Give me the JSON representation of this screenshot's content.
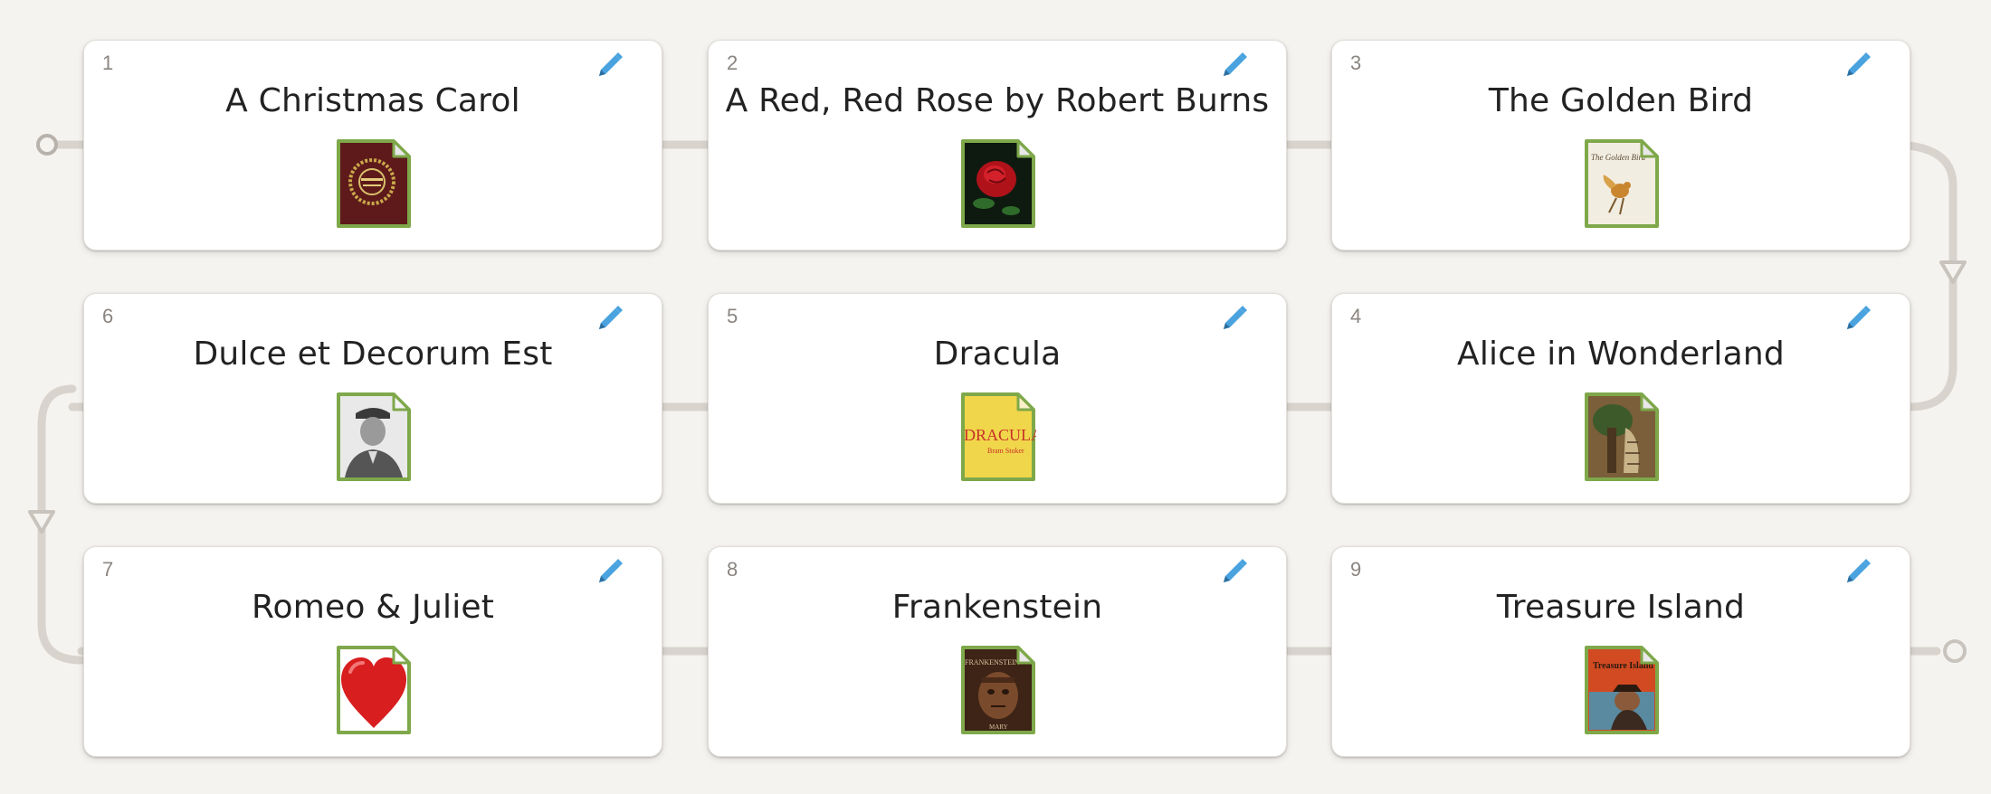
{
  "cards": [
    {
      "number": "1",
      "title": "A Christmas Carol",
      "thumb_icon": "christmas-carol-cover-icon"
    },
    {
      "number": "2",
      "title": "A Red, Red Rose by Robert Burns",
      "thumb_icon": "red-rose-icon"
    },
    {
      "number": "3",
      "title": "The Golden Bird",
      "thumb_icon": "golden-bird-cover-icon",
      "thumb_text": "The Golden Bird"
    },
    {
      "number": "4",
      "title": "Alice in Wonderland",
      "thumb_icon": "alice-cover-icon"
    },
    {
      "number": "5",
      "title": "Dracula",
      "thumb_icon": "dracula-cover-icon",
      "thumb_text": "DRACULA",
      "thumb_subtext": "Bram Stoker"
    },
    {
      "number": "6",
      "title": "Dulce et Decorum Est",
      "thumb_icon": "soldier-portrait-icon"
    },
    {
      "number": "7",
      "title": "Romeo & Juliet",
      "thumb_icon": "heart-icon"
    },
    {
      "number": "8",
      "title": "Frankenstein",
      "thumb_icon": "frankenstein-cover-icon",
      "thumb_text": "FRANKENSTEIN",
      "thumb_subtext": "MARY"
    },
    {
      "number": "9",
      "title": "Treasure Island",
      "thumb_icon": "treasure-island-cover-icon",
      "thumb_text": "Treasure Island"
    }
  ],
  "colors": {
    "background": "#f5f3ef",
    "path": "#d9d3cd",
    "edit_icon": "#4aa3df",
    "thumb_border": "#7ea84a",
    "card_number": "#8a8580"
  },
  "icons": {
    "edit": "pencil-icon",
    "path_start": "circle-start-icon",
    "path_end": "circle-end-icon",
    "path_arrow": "triangle-down-icon"
  }
}
